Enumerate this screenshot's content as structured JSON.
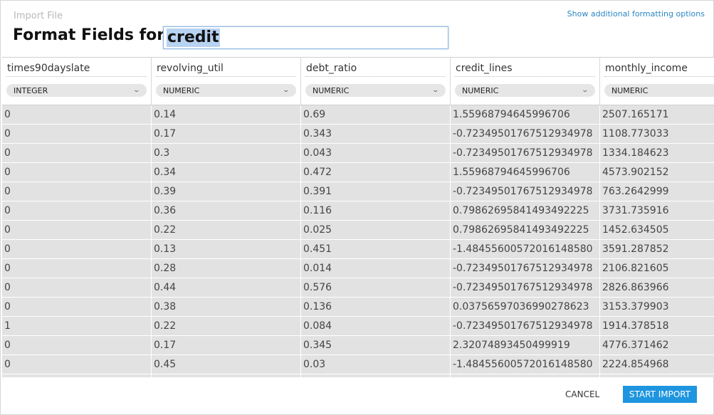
{
  "header": {
    "breadcrumb": "Import File",
    "title": "Format Fields for",
    "dataset_name": "credit",
    "more_options_link": "Show additional formatting options"
  },
  "columns": [
    {
      "name": "times90dayslate",
      "type": "INTEGER"
    },
    {
      "name": "revolving_util",
      "type": "NUMERIC"
    },
    {
      "name": "debt_ratio",
      "type": "NUMERIC"
    },
    {
      "name": "credit_lines",
      "type": "NUMERIC"
    },
    {
      "name": "monthly_income",
      "type": "NUMERIC"
    }
  ],
  "rows": [
    [
      "0",
      "0.14",
      "0.69",
      "1.55968794645996706",
      "2507.165171"
    ],
    [
      "0",
      "0.17",
      "0.343",
      "-0.72349501767512934978",
      "1108.773033"
    ],
    [
      "0",
      "0.3",
      "0.043",
      "-0.72349501767512934978",
      "1334.184623"
    ],
    [
      "0",
      "0.34",
      "0.472",
      "1.55968794645996706",
      "4573.902152"
    ],
    [
      "0",
      "0.39",
      "0.391",
      "-0.72349501767512934978",
      "763.2642999"
    ],
    [
      "0",
      "0.36",
      "0.116",
      "0.79862695841493492225",
      "3731.735916"
    ],
    [
      "0",
      "0.22",
      "0.025",
      "0.79862695841493492225",
      "1452.634505"
    ],
    [
      "0",
      "0.13",
      "0.451",
      "-1.48455600572016148580",
      "3591.287852"
    ],
    [
      "0",
      "0.28",
      "0.014",
      "-0.72349501767512934978",
      "2106.821605"
    ],
    [
      "0",
      "0.44",
      "0.576",
      "-0.72349501767512934978",
      "2826.863966"
    ],
    [
      "0",
      "0.38",
      "0.136",
      "0.03756597036990278623",
      "3153.379903"
    ],
    [
      "1",
      "0.22",
      "0.084",
      "-0.72349501767512934978",
      "1914.378518"
    ],
    [
      "0",
      "0.17",
      "0.345",
      "2.32074893450499919",
      "4776.371462"
    ],
    [
      "0",
      "0.45",
      "0.03",
      "-1.48455600572016148580",
      "2224.854968"
    ],
    [
      "",
      "",
      "",
      "",
      ""
    ]
  ],
  "footer": {
    "cancel_label": "CANCEL",
    "start_label": "START IMPORT"
  },
  "colors": {
    "accent": "#1e95df",
    "link": "#2b86c5",
    "grid_bg": "#e2e2e2"
  },
  "icons": {
    "dropdown": "chevron-down-icon"
  }
}
